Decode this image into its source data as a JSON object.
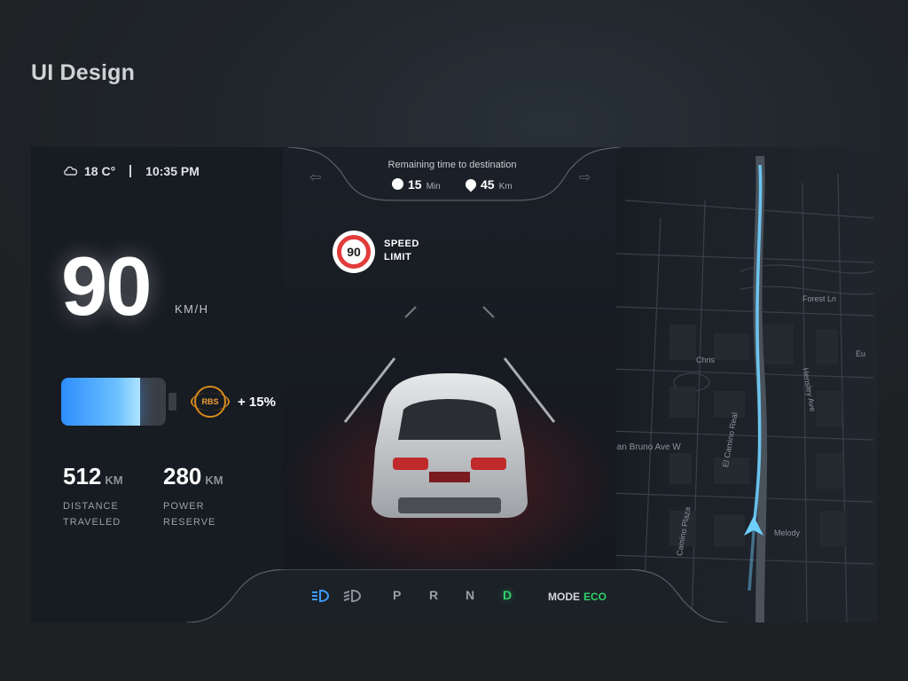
{
  "page_title": "UI Design",
  "weather": {
    "temperature": "18 C°",
    "icon": "cloud-icon"
  },
  "clock": {
    "time": "10:35 PM"
  },
  "navigation": {
    "remaining_label": "Remaining time to destination",
    "time_value": "15",
    "time_unit": "Min",
    "distance_value": "45",
    "distance_unit": "Km"
  },
  "speed": {
    "value": "90",
    "unit": "KM/H"
  },
  "speed_limit": {
    "value": "90",
    "label_line1": "SPEED",
    "label_line2": "LIMIT"
  },
  "battery": {
    "level": 0.75,
    "fill_color": "#3a9dff"
  },
  "rbs": {
    "label": "RBS",
    "percent": "+ 15%"
  },
  "stats": {
    "distance": {
      "value": "512",
      "unit": "KM",
      "label_line1": "DISTANCE",
      "label_line2": "TRAVELED"
    },
    "reserve": {
      "value": "280",
      "unit": "KM",
      "label_line1": "POWER",
      "label_line2": "RESERVE"
    }
  },
  "map": {
    "streets": [
      "Forest Ln",
      "Chris",
      "Hensley Ave",
      "San Bruno Ave W",
      "El Camino Real",
      "Camino Plaza",
      "Melody",
      "Eu"
    ]
  },
  "gears": {
    "items": [
      "P",
      "R",
      "N",
      "D"
    ],
    "active": "D"
  },
  "mode": {
    "label": "MODE",
    "value": "ECO"
  },
  "colors": {
    "accent_green": "#2fd36a",
    "accent_blue": "#3a9dff",
    "route": "#6fd0ff",
    "limit_red": "#e23b3b",
    "rbs_orange": "#d88a1c"
  }
}
